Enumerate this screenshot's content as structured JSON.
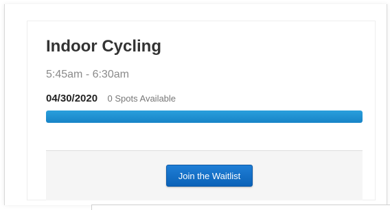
{
  "class_card": {
    "title": "Indoor Cycling",
    "time_range": "5:45am - 6:30am",
    "date": "04/30/2020",
    "spots_text": "0 Spots Available",
    "capacity_filled_fraction": 1.0,
    "accent_color": "#1a8ad0",
    "button_color": "#0f6cc8",
    "waitlist_button_label": "Join the Waitlist"
  }
}
